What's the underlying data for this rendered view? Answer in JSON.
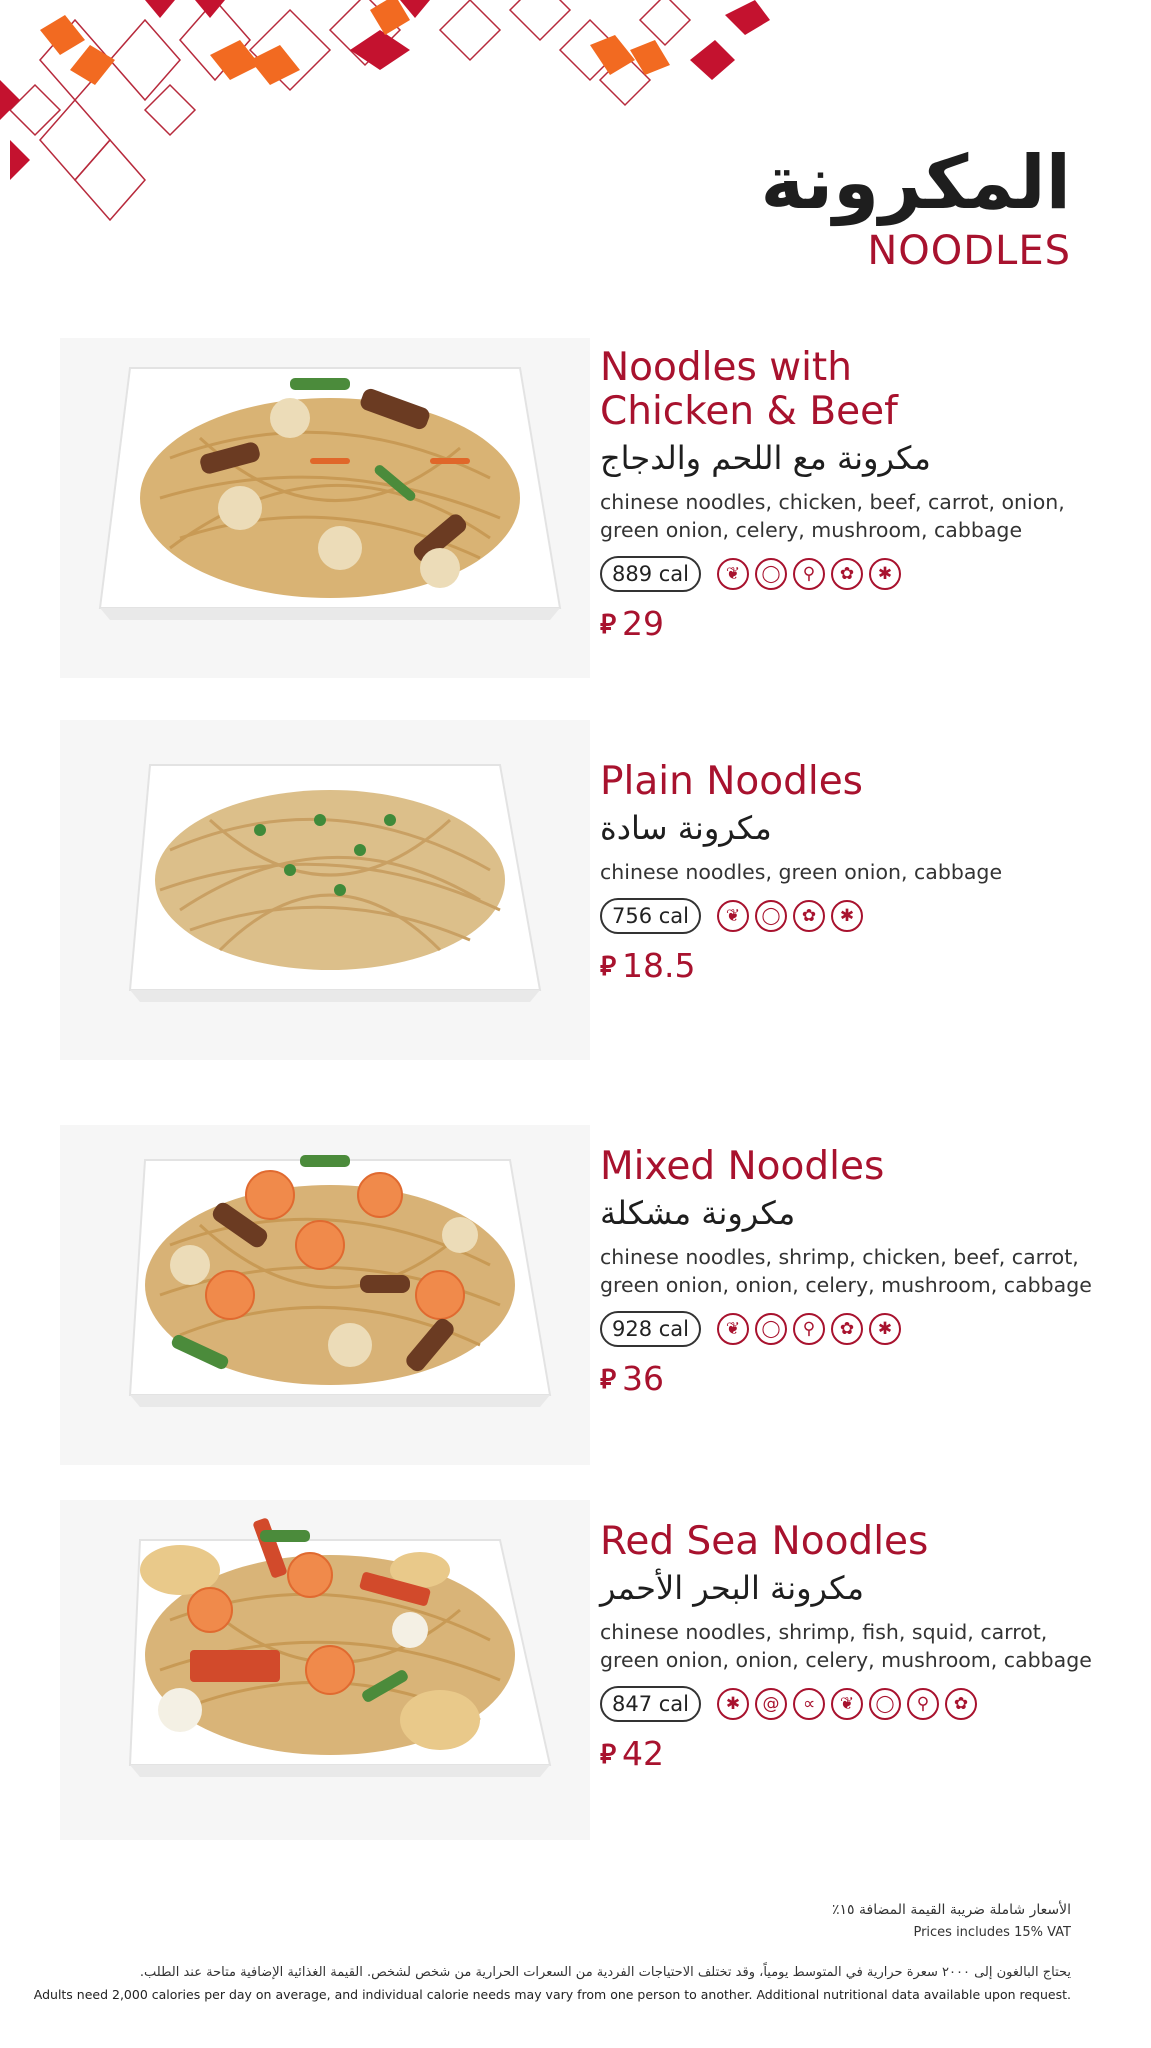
{
  "colors": {
    "accent": "#a8122e",
    "orange": "#f26a21",
    "text": "#1e1e1e"
  },
  "header": {
    "title_ar": "المكرونة",
    "title_en": "NOODLES"
  },
  "items": [
    {
      "name_en_line1": "Noodles with",
      "name_en_line2": "Chicken & Beef",
      "name_ar": "مكرونة مع اللحم والدجاج",
      "desc_line1": "chinese noodles, chicken, beef, carrot, onion,",
      "desc_line2": "green onion, celery, mushroom, cabbage",
      "calories": "889 cal",
      "allergen_icons": [
        "celery-icon",
        "egg-icon",
        "carrot-icon",
        "mushroom-icon",
        "crab-icon"
      ],
      "currency": "⃁",
      "price": "29"
    },
    {
      "name_en_line1": "Plain Noodles",
      "name_ar": "مكرونة سادة",
      "desc_line1": "chinese noodles, green onion, cabbage",
      "calories": "756 cal",
      "allergen_icons": [
        "celery-icon",
        "egg-icon",
        "mushroom-icon",
        "crab-icon"
      ],
      "currency": "⃁",
      "price": "18.5"
    },
    {
      "name_en_line1": "Mixed Noodles",
      "name_ar": "مكرونة مشكلة",
      "desc_line1": "chinese noodles, shrimp, chicken, beef, carrot,",
      "desc_line2": "green onion, onion, celery, mushroom, cabbage",
      "calories": "928 cal",
      "allergen_icons": [
        "celery-icon",
        "egg-icon",
        "carrot-icon",
        "mushroom-icon",
        "crab-icon"
      ],
      "currency": "⃁",
      "price": "36"
    },
    {
      "name_en_line1": "Red Sea Noodles",
      "name_ar": "مكرونة البحر الأحمر",
      "desc_line1": "chinese noodles, shrimp, fish, squid, carrot,",
      "desc_line2": "green onion, onion, celery, mushroom, cabbage",
      "calories": "847 cal",
      "allergen_icons": [
        "crab-icon",
        "snail-icon",
        "fish-icon",
        "celery-icon",
        "egg-icon",
        "carrot-icon",
        "mushroom-icon"
      ],
      "currency": "⃁",
      "price": "42"
    }
  ],
  "footer": {
    "vat_ar": "الأسعار شاملة ضريبة القيمة المضافة ١٥٪",
    "vat_en": "Prices includes 15% VAT",
    "note_ar": "يحتاج البالغون إلى ٢٠٠٠ سعرة حرارية في المتوسط يومياً، وقد تختلف الاحتياجات الفردية من السعرات الحرارية من شخص لشخص. القيمة الغذائية الإضافية متاحة عند الطلب.",
    "note_en": "Adults need 2,000 calories per day on average, and individual calorie needs may vary from one person to another. Additional nutritional data available upon request."
  }
}
